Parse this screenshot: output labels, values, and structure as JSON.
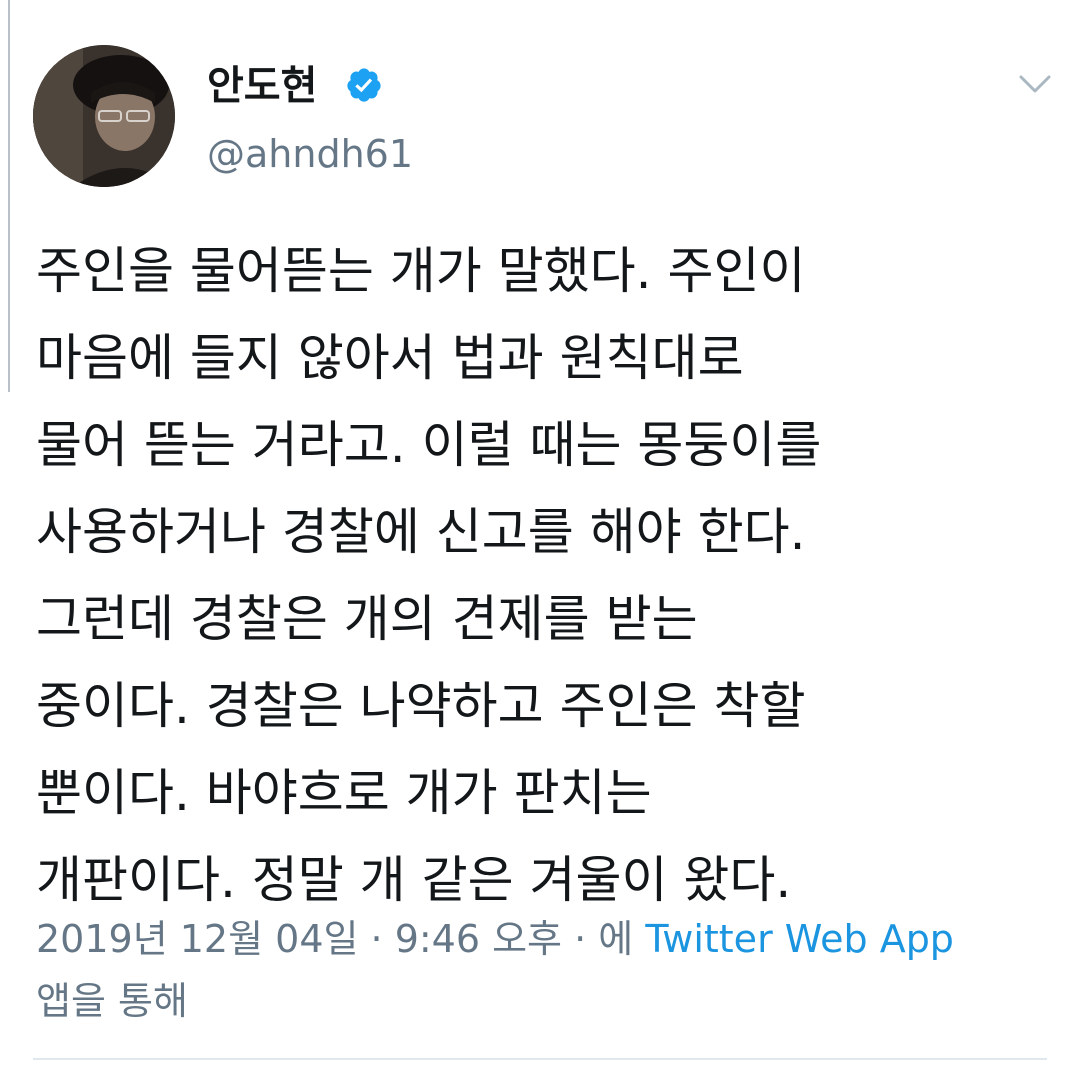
{
  "tweet": {
    "author": {
      "name": "안도현",
      "handle": "@ahndh61",
      "verified": true,
      "avatar_icon": "person-avatar"
    },
    "body_lines": [
      "주인을 물어뜯는 개가 말했다. 주인이",
      "마음에 들지 않아서 법과 원칙대로",
      "물어 뜯는 거라고. 이럴 때는 몽둥이를",
      "사용하거나 경찰에 신고를 해야 한다.",
      "그런데 경찰은 개의 견제를 받는",
      "중이다. 경찰은 나약하고 주인은 착할",
      "뿐이다. 바야흐로 개가 판치는",
      "개판이다. 정말 개 같은 겨울이 왔다."
    ],
    "timestamp": "2019년 12월 04일 · 9:46 오후 · 에",
    "source": "Twitter Web App",
    "source_suffix": "앱을 통해"
  },
  "colors": {
    "text": "#14171a",
    "secondary": "#657786",
    "link": "#1b95e0",
    "verified": "#1da1f2",
    "divider": "#e1e8ed"
  },
  "icons": {
    "verified": "verified-badge-icon",
    "menu": "chevron-down-icon"
  }
}
